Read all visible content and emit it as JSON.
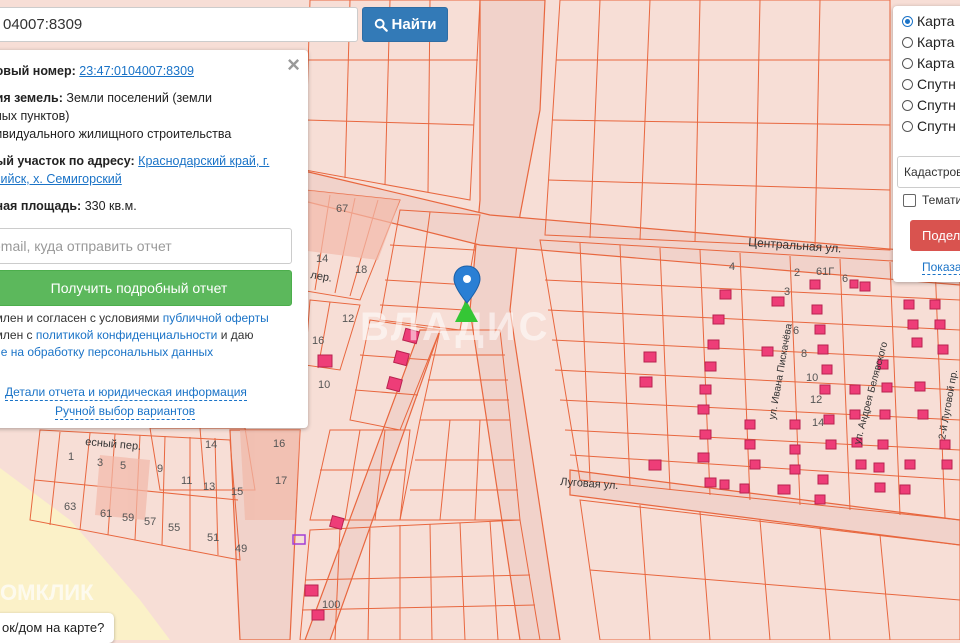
{
  "search": {
    "value": "04007:8309",
    "button_label": "Найти"
  },
  "info": {
    "cad_label": "ровый номер:",
    "cad_value": "23:47:0104007:8309",
    "category_label": "рия земель:",
    "category_value_1": "Земли поселений (земли",
    "category_value_2": "нных пунктов)",
    "category_value_3": "дивидуального жилищного строительства",
    "address_label": "ный участок по адресу:",
    "address_value_1": "Краснодарский край, г.",
    "address_value_2": "ссийск, х. Семигорский",
    "area_label": "нная площадь:",
    "area_value": "330 кв.м.",
    "email_placeholder": "email, куда отправить отчет",
    "report_button": "Получить подробный отчет",
    "terms_1_pre": "омлен и согласен с условиями ",
    "terms_1_link": "публичной оферты",
    "terms_2_pre": "омлен с ",
    "terms_2_link": "политикой конфиденциальности",
    "terms_2_post": " и даю",
    "terms_3_link": "сие на обработку персональных данных",
    "details_link": "Детали отчета и юридическая информация",
    "manual_link": "Ручной выбор вариантов"
  },
  "layers": {
    "options": [
      "Карта",
      "Карта",
      "Карта",
      "Спутн",
      "Спутн",
      "Спутн"
    ],
    "selected_index": 0,
    "cadastre_select": "Кадастров",
    "thematic_label": "Темати",
    "share_button": "Подел",
    "show_link": "Показа"
  },
  "map": {
    "streets": {
      "central": "Центральная ул.",
      "lugovaya": "Луговая ул.",
      "lesnoy": "есный пер.",
      "ler": "лер.",
      "ivana": "ул. Ивана Пискачёва",
      "andr": "ул. Андрея Белявского",
      "lugovoy2": "2-й Луговой пр."
    },
    "watermark": "ВЛАДИС",
    "domklik": "ОМКЛИК",
    "numbers": [
      "67",
      "14",
      "18",
      "12",
      "16",
      "14",
      "16",
      "17",
      "1",
      "3",
      "5",
      "9",
      "11",
      "13",
      "15",
      "63",
      "61",
      "59",
      "57",
      "55",
      "51",
      "49",
      "10",
      "4",
      "2",
      "6",
      "8",
      "10",
      "12",
      "14",
      "3",
      "6",
      "61Г",
      "100"
    ]
  },
  "question": "ок/дом на карте?",
  "colors": {
    "parcel_fill": "#f7ded6",
    "parcel_line": "#e8673f",
    "building": "#ee3d78",
    "marker": "#2a7fd4",
    "green_marker": "#35c635",
    "road": "#f1d2ca"
  }
}
